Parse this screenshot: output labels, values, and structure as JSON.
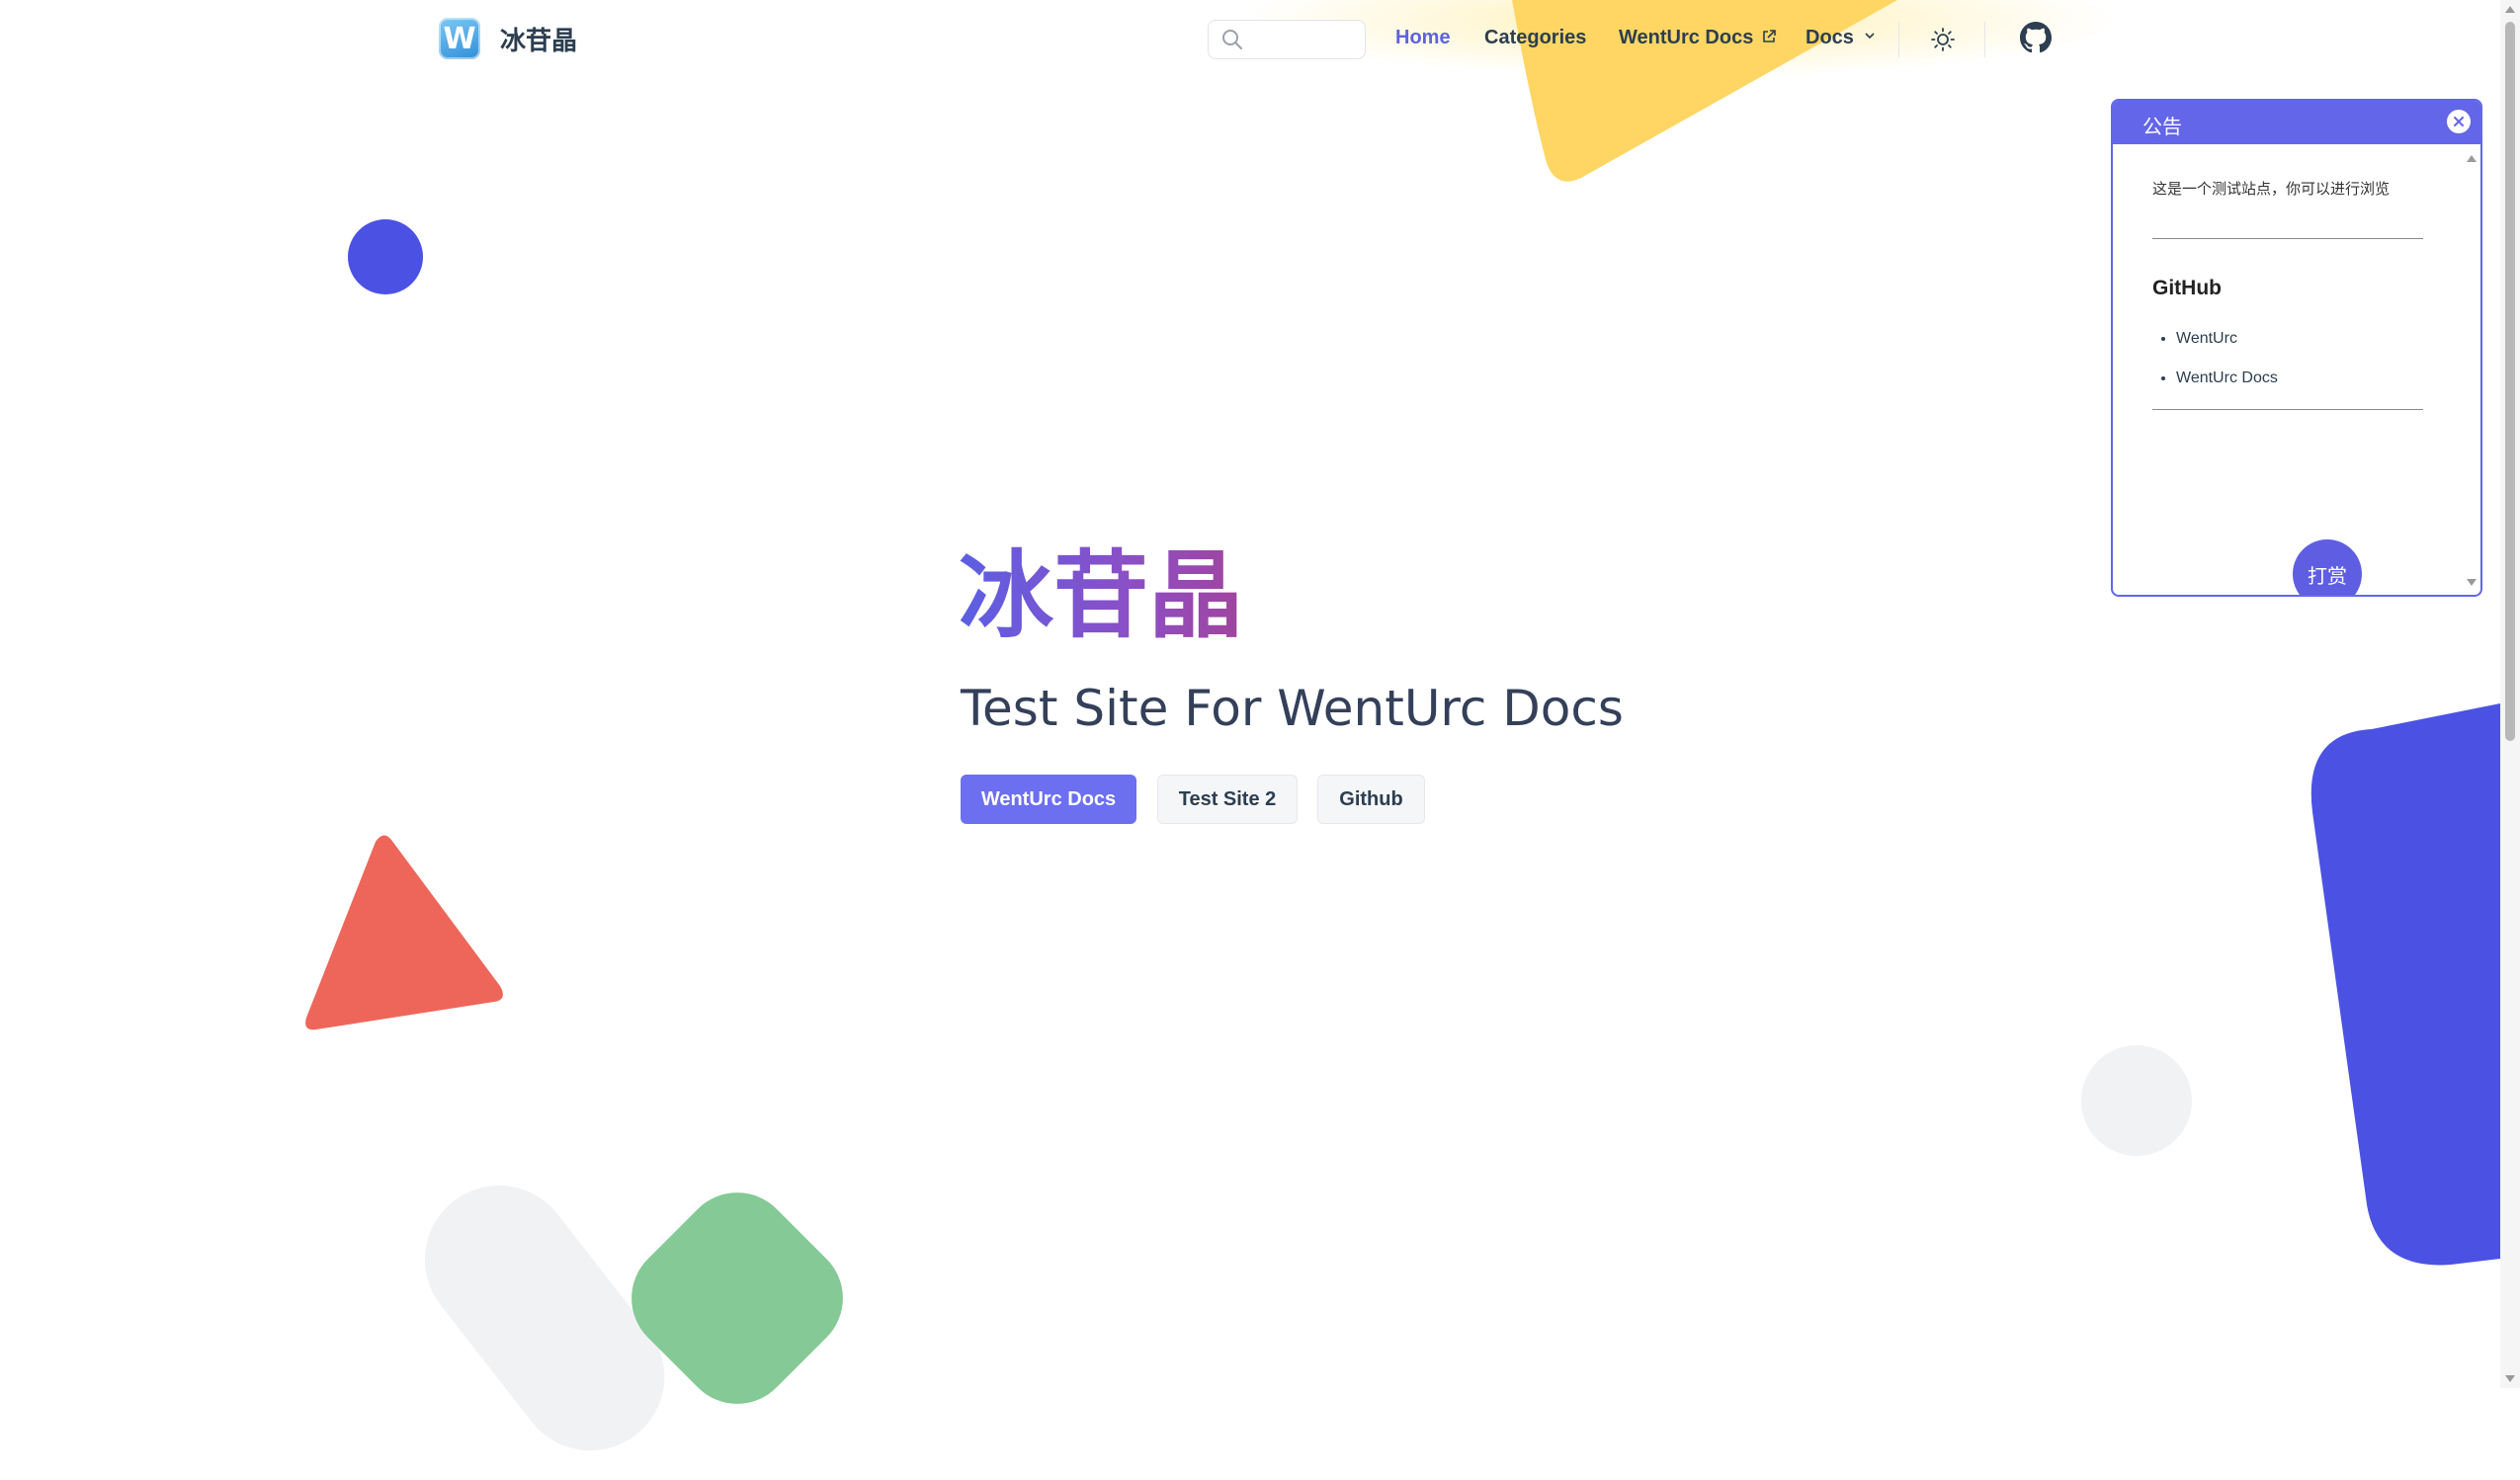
{
  "brand": {
    "name": "冰苷晶",
    "logo_letter": "W"
  },
  "search": {
    "placeholder": "",
    "value": ""
  },
  "nav": {
    "home": "Home",
    "categories": "Categories",
    "wenturc_docs": "WentUrc Docs",
    "docs": "Docs"
  },
  "hero": {
    "title": "冰苷晶",
    "subtitle": "Test Site For WentUrc Docs",
    "actions": [
      "WentUrc Docs",
      "Test Site 2",
      "Github"
    ]
  },
  "notice": {
    "title": "公告",
    "text": "这是一个测试站点，你可以进行浏览",
    "heading": "GitHub",
    "links": [
      "WentUrc",
      "WentUrc Docs"
    ],
    "button": "打赏"
  },
  "colors": {
    "accent": "#5c63e0",
    "primary_button": "#6b6ff0",
    "notice_header": "#6366e8",
    "shape_blue": "#4b52e3",
    "shape_red": "#ee665a",
    "shape_green": "#84c996",
    "shape_yellow": "#ffd663",
    "shape_gray": "#f1f2f4"
  },
  "icons": [
    "search-icon",
    "external-link-icon",
    "chevron-down-icon",
    "sun-icon",
    "github-icon",
    "close-icon",
    "w-logo-icon"
  ]
}
